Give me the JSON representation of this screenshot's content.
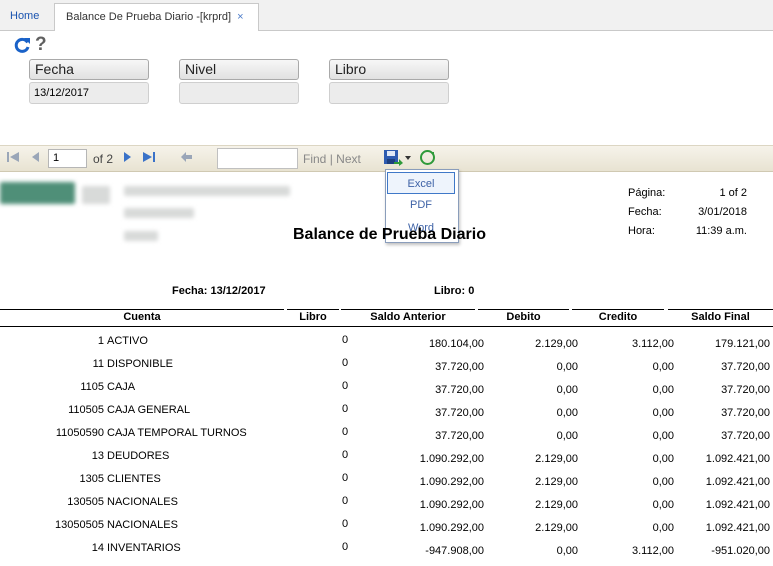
{
  "tabs": [
    {
      "label": "Home"
    },
    {
      "label": "Balance De Prueba Diario -[krprd]",
      "close": "×"
    }
  ],
  "toolbar_icons": {
    "refresh": "refresh-icon",
    "help": "?"
  },
  "params": [
    {
      "label": "Fecha",
      "value": "13/12/2017"
    },
    {
      "label": "Nivel",
      "value": ""
    },
    {
      "label": "Libro",
      "value": ""
    }
  ],
  "viewer": {
    "page_input": "1",
    "of_text": "of 2",
    "search_value": "",
    "find_label": "Find",
    "separator": "|",
    "next_label": "Next"
  },
  "export_menu": [
    "Excel",
    "PDF",
    "Word"
  ],
  "report": {
    "title": "Balance de Prueba Diario",
    "pagina_label": "Página:",
    "pagina_value": "1 of 2",
    "fecha_label": "Fecha:",
    "fecha_value": "3/01/2018",
    "hora_label": "Hora:",
    "hora_value": "11:39 a.m.",
    "fecha_corte": "Fecha: 13/12/2017",
    "libro": "Libro: 0",
    "columns": [
      "Cuenta",
      "Libro",
      "Saldo Anterior",
      "Debito",
      "Credito",
      "Saldo Final"
    ],
    "rows": [
      {
        "cuenta": "1",
        "nombre": "ACTIVO",
        "libro": "0",
        "anterior": "180.104,00",
        "debito": "2.129,00",
        "credito": "3.112,00",
        "final": "179.121,00"
      },
      {
        "cuenta": "11",
        "nombre": "DISPONIBLE",
        "libro": "0",
        "anterior": "37.720,00",
        "debito": "0,00",
        "credito": "0,00",
        "final": "37.720,00"
      },
      {
        "cuenta": "1105",
        "nombre": "CAJA",
        "libro": "0",
        "anterior": "37.720,00",
        "debito": "0,00",
        "credito": "0,00",
        "final": "37.720,00"
      },
      {
        "cuenta": "110505",
        "nombre": "CAJA GENERAL",
        "libro": "0",
        "anterior": "37.720,00",
        "debito": "0,00",
        "credito": "0,00",
        "final": "37.720,00"
      },
      {
        "cuenta": "11050590",
        "nombre": "CAJA TEMPORAL TURNOS",
        "libro": "0",
        "anterior": "37.720,00",
        "debito": "0,00",
        "credito": "0,00",
        "final": "37.720,00"
      },
      {
        "cuenta": "13",
        "nombre": "DEUDORES",
        "libro": "0",
        "anterior": "1.090.292,00",
        "debito": "2.129,00",
        "credito": "0,00",
        "final": "1.092.421,00"
      },
      {
        "cuenta": "1305",
        "nombre": "CLIENTES",
        "libro": "0",
        "anterior": "1.090.292,00",
        "debito": "2.129,00",
        "credito": "0,00",
        "final": "1.092.421,00"
      },
      {
        "cuenta": "130505",
        "nombre": "NACIONALES",
        "libro": "0",
        "anterior": "1.090.292,00",
        "debito": "2.129,00",
        "credito": "0,00",
        "final": "1.092.421,00"
      },
      {
        "cuenta": "13050505",
        "nombre": "NACIONALES",
        "libro": "0",
        "anterior": "1.090.292,00",
        "debito": "2.129,00",
        "credito": "0,00",
        "final": "1.092.421,00"
      },
      {
        "cuenta": "14",
        "nombre": "INVENTARIOS",
        "libro": "0",
        "anterior": "-947.908,00",
        "debito": "0,00",
        "credito": "3.112,00",
        "final": "-951.020,00"
      }
    ]
  }
}
